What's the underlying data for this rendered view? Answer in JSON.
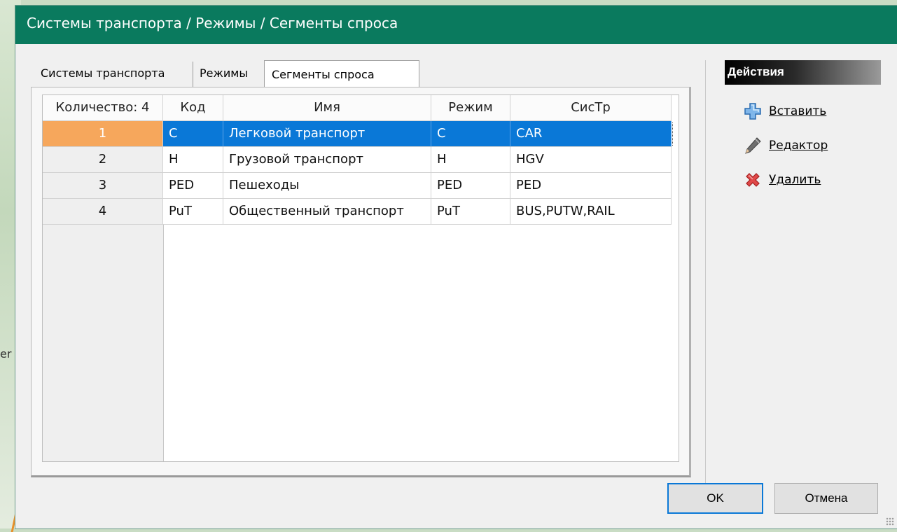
{
  "window": {
    "title": "Системы транспорта / Режимы / Сегменты спроса"
  },
  "background": {
    "map_label": "er"
  },
  "tabs": [
    {
      "label": "Системы транспорта",
      "active": false
    },
    {
      "label": "Режимы",
      "active": false
    },
    {
      "label": "Сегменты спроса",
      "active": true
    }
  ],
  "grid": {
    "count_label": "Количество: 4",
    "columns": [
      "Код",
      "Имя",
      "Режим",
      "СисТр"
    ],
    "selected_row": 1,
    "rows": [
      {
        "num": "1",
        "code": "C",
        "name": "Легковой транспорт",
        "mode": "C",
        "tsys": "CAR"
      },
      {
        "num": "2",
        "code": "H",
        "name": "Грузовой транспорт",
        "mode": "H",
        "tsys": "HGV"
      },
      {
        "num": "3",
        "code": "PED",
        "name": "Пешеходы",
        "mode": "PED",
        "tsys": "PED"
      },
      {
        "num": "4",
        "code": "PuT",
        "name": "Общественный транспорт",
        "mode": "PuT",
        "tsys": "BUS,PUTW,RAIL"
      }
    ]
  },
  "actions": {
    "header": "Действия",
    "items": [
      {
        "label": "Вставить",
        "icon": "plus-icon"
      },
      {
        "label": "Редактор",
        "icon": "pencil-icon"
      },
      {
        "label": "Удалить",
        "icon": "delete-x-icon"
      }
    ]
  },
  "buttons": {
    "ok": "OK",
    "cancel": "Отмена"
  },
  "colors": {
    "titlebar": "#0a7a5e",
    "selection": "#0a78d7",
    "selected_row_header": "#f6a75c"
  }
}
